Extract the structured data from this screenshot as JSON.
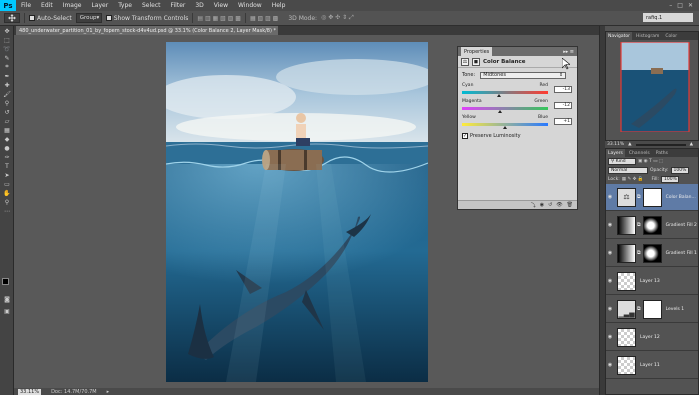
{
  "app": {
    "logo": "Ps"
  },
  "menubar": {
    "items": [
      "File",
      "Edit",
      "Image",
      "Layer",
      "Type",
      "Select",
      "Filter",
      "3D",
      "View",
      "Window",
      "Help"
    ]
  },
  "options": {
    "auto_select_label": "Auto-Select",
    "group_select": "Group",
    "show_transform_label": "Show Transform Controls",
    "mode_3d_label": "3D Mode:"
  },
  "workspace": {
    "value": "rafiq.1"
  },
  "document": {
    "tab_title": "480_underwater_partition_01_by_fopem_stock-d4v4ud.psd @ 33.1% (Color Balance 2, Layer Mask/8) *"
  },
  "status": {
    "zoom": "33.11%",
    "doc_info": "Doc: 14.7M/70.7M"
  },
  "properties": {
    "tab": "Properties",
    "title": "Color Balance",
    "tone_label": "Tone:",
    "tone_value": "Midtones",
    "sliders": [
      {
        "left": "Cyan",
        "right": "Red",
        "value": "-13",
        "fraction": 0.435,
        "gradient": [
          "#00bcd4",
          "#ff3b30"
        ]
      },
      {
        "left": "Magenta",
        "right": "Green",
        "value": "-12",
        "fraction": 0.44,
        "gradient": [
          "#e040fb",
          "#34c759"
        ]
      },
      {
        "left": "Yellow",
        "right": "Blue",
        "value": "+1",
        "fraction": 0.505,
        "gradient": [
          "#ffeb3b",
          "#2979ff"
        ]
      }
    ],
    "preserve_label": "Preserve Luminosity",
    "preserve_checked": true
  },
  "navigator": {
    "tabs": [
      "Navigator",
      "Histogram",
      "Color"
    ],
    "zoom": "33.11%"
  },
  "layers": {
    "tabs": [
      "Layers",
      "Channels",
      "Paths"
    ],
    "kind_label": "Kind",
    "blend_mode": "Normal",
    "opacity_label": "Opacity:",
    "opacity": "100%",
    "lock_label": "Lock:",
    "fill_label": "Fill:",
    "fill": "100%",
    "items": [
      {
        "name": "Color Balan...",
        "type": "adjust",
        "active": true
      },
      {
        "name": "Gradient Fill 2",
        "type": "gradient",
        "active": false
      },
      {
        "name": "Gradient Fill 1",
        "type": "gradient",
        "active": false
      },
      {
        "name": "Layer 13",
        "type": "pixel",
        "active": false
      },
      {
        "name": "Levels 1",
        "type": "levels",
        "active": false
      },
      {
        "name": "Layer 12",
        "type": "pixel",
        "active": false
      },
      {
        "name": "Layer 11",
        "type": "pixel",
        "active": false
      }
    ]
  }
}
